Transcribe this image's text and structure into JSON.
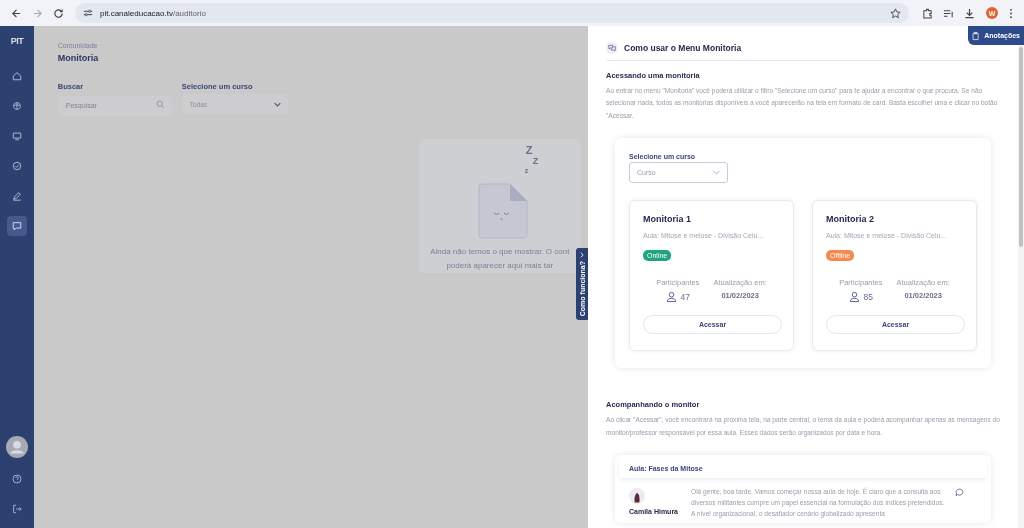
{
  "browser": {
    "url_host": "pit.canaleducacao.tv",
    "url_path": "/auditorio",
    "profile_initial": "W"
  },
  "sidebar": {
    "logo": "PIT",
    "items": [
      {
        "kind": "home",
        "selected": false
      },
      {
        "kind": "brain",
        "selected": false
      },
      {
        "kind": "monitor",
        "selected": false
      },
      {
        "kind": "check",
        "selected": false
      },
      {
        "kind": "pen",
        "selected": false
      },
      {
        "kind": "chat",
        "selected": true
      }
    ],
    "bottom": [
      {
        "kind": "avatar"
      },
      {
        "kind": "help"
      },
      {
        "kind": "logout"
      }
    ]
  },
  "page": {
    "breadcrumb": "Comunidade",
    "title": "Monitoria",
    "search": {
      "label": "Buscar",
      "placeholder": "Pesquisar"
    },
    "course_select": {
      "label": "Selecione um curso",
      "value": "Todas"
    },
    "empty_state": {
      "sleep_marks": [
        "Z",
        "Z",
        "z"
      ],
      "lines": [
        "Ainda não temos o que mostrar. O cont",
        "poderá aparecer aqui mais tar"
      ]
    },
    "help_tab": "Como funciona?"
  },
  "panel": {
    "title": "Como usar o Menu Monitoria",
    "notes_button": "Anotações",
    "section_1": {
      "heading": "Acessando uma monitoria",
      "text": "Ao entrar no menu \"Monitoria\" você poderá utilizar o filtro \"Selecione um curso\" para te ajudar a encontrar o que procura. Se não selecionar nada, todos as monitorias disponíveis a você aparecerão na tela em formato de card. Basta escolher uma e clicar no botão \"Acessar.",
      "example": {
        "select_label": "Selecione um curso",
        "select_placeholder": "Curso",
        "cards": [
          {
            "title": "Monitoria 1",
            "subtitle": "Aula: Mitose e meiose - Divisão Celu...",
            "status": {
              "label": "Online",
              "color": "#1fa383"
            },
            "participants_label": "Participantes",
            "participants": "47",
            "updated_label": "Atualização em:",
            "updated": "01/02/2023",
            "button": "Acessar"
          },
          {
            "title": "Monitoria 2",
            "subtitle": "Aula: Mitose e meiose - Divisão Celu...",
            "status": {
              "label": "Offline",
              "color": "#f58a4f"
            },
            "participants_label": "Participantes",
            "participants": "85",
            "updated_label": "Atualização em:",
            "updated": "01/02/2023",
            "button": "Acessar"
          }
        ]
      }
    },
    "section_2": {
      "heading": "Acompanhando o monitor",
      "text": "Ao clicar \"Acessar\", você encontrará na próxima tela, na parte central, o tema da aula e poderá acompanhar apenas as mensagens do monitor/professor responsável por essa aula. Esses dados serão organizados por data e hora.",
      "example": {
        "lesson": "Aula: Fases da Mitose",
        "message": {
          "author": "Camila Himura",
          "text": "Olá gente, boa tarde. Vamos começar nossa aula de hoje. É claro que a consulta aos diversos militantes cumpre um papel essencial na formulação dos índices pretendidos. A nível organizacional, o desafiador cenário globalizado apresenta"
        }
      }
    }
  }
}
